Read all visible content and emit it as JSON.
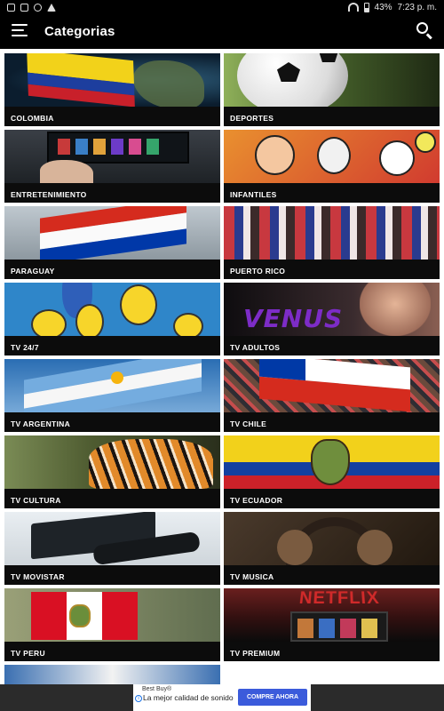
{
  "status_bar": {
    "battery": "43%",
    "time": "7:23 p. m."
  },
  "app_bar": {
    "title": "Categorias",
    "menu_icon": "hamburger-menu-icon",
    "search_icon": "search-icon"
  },
  "categories": [
    {
      "label": "COLOMBIA"
    },
    {
      "label": "DEPORTES"
    },
    {
      "label": "ENTRETENIMIENTO"
    },
    {
      "label": "INFANTILES"
    },
    {
      "label": "PARAGUAY"
    },
    {
      "label": "PUERTO RICO"
    },
    {
      "label": "TV 24/7"
    },
    {
      "label": "TV ADULTOS"
    },
    {
      "label": "TV ARGENTINA"
    },
    {
      "label": "TV CHILE"
    },
    {
      "label": "TV CULTURA"
    },
    {
      "label": "TV ECUADOR"
    },
    {
      "label": "TV MOVISTAR"
    },
    {
      "label": "TV MUSICA"
    },
    {
      "label": "TV PERU"
    },
    {
      "label": "TV PREMIUM"
    }
  ],
  "thumb_text": {
    "venus": "VENUS",
    "netflix": "NETFLIX"
  },
  "ad": {
    "brand": "Best Buy®",
    "text": "La mejor calidad de sonido",
    "button": "COMPRE AHORA"
  },
  "colors": {
    "accent_button": "#3b5bdb",
    "app_bar": "#000000",
    "label_bar": "#0c0c0c"
  }
}
